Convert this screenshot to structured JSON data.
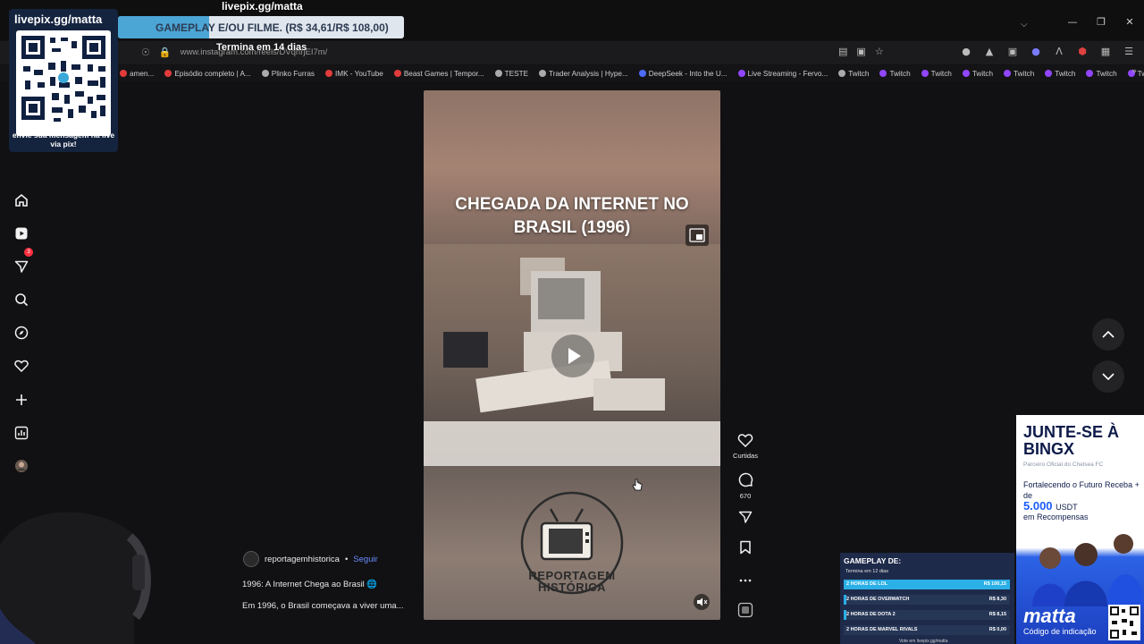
{
  "browser": {
    "url": "www.instagram.com/reels/DVqhrjEI7m/",
    "bookmarks": [
      {
        "label": "amen...",
        "color": "#e23b3b"
      },
      {
        "label": "Episódio completo | A...",
        "color": "#e23b3b"
      },
      {
        "label": "Plinko Furras",
        "color": "#aaaaaa"
      },
      {
        "label": "IMK - YouTube",
        "color": "#e23b3b"
      },
      {
        "label": "Beast Games | Tempor...",
        "color": "#e23b3b"
      },
      {
        "label": "TESTE",
        "color": "#aaaaaa"
      },
      {
        "label": "Trader Analysis | Hype...",
        "color": "#aaaaaa"
      },
      {
        "label": "DeepSeek - Into the U...",
        "color": "#4d6bfe"
      },
      {
        "label": "Live Streaming - Fervo...",
        "color": "#9146ff"
      },
      {
        "label": "Twitch",
        "color": "#aaaaaa"
      },
      {
        "label": "Twitch",
        "color": "#9146ff"
      },
      {
        "label": "Twitch",
        "color": "#9146ff"
      },
      {
        "label": "Twitch",
        "color": "#9146ff"
      },
      {
        "label": "Twitch",
        "color": "#9146ff"
      },
      {
        "label": "Twitch",
        "color": "#9146ff"
      },
      {
        "label": "Twitch",
        "color": "#9146ff"
      },
      {
        "label": "Twitch",
        "color": "#9146ff"
      }
    ]
  },
  "overlay": {
    "livepix_title": "livepix.gg/matta",
    "goal_text": "GAMEPLAY E/OU FILME. (R$ 34,61/R$ 108,00)",
    "goal_progress": 0.32,
    "goal_sub": "Termina em 14 dias",
    "qr_title": "livepix.gg/matta",
    "qr_caption": "envie sua mensagem na live via pix!"
  },
  "sidebar": {
    "notification_count": "3"
  },
  "reel": {
    "caption": "CHEGADA DA INTERNET NO BRASIL (1996)",
    "logo_text": "REPORTAGEM HISTÓRICA",
    "likes_label": "Curtidas",
    "comments_count": "670",
    "author": "reportagemhistorica",
    "separator": "•",
    "follow_label": "Seguir",
    "desc_line1": "1996: A Internet Chega ao Brasil 🌐",
    "desc_line2": "Em 1996, o Brasil começava a viver uma..."
  },
  "promo": {
    "title": "JUNTE-SE À BINGX",
    "subtitle": "Parceiro Oficial do Chelsea FC",
    "line1": "Fortalecendo o Futuro Receba + de",
    "amount": "5.000",
    "amount_unit": "USDT",
    "line2": "em Recompensas",
    "brand": "matta",
    "code_label": "Código de indicação"
  },
  "poll": {
    "title": "GAMEPLAY DE:",
    "subtitle": "Termina em 12 dias",
    "options": [
      {
        "label": "2 HORAS DE LOL",
        "value": "R$ 100,15",
        "share": 1.0
      },
      {
        "label": "2 HORAS DE OVERWATCH",
        "value": "R$ 8,30",
        "share": 0.04
      },
      {
        "label": "2 HORAS DE DOTA 2",
        "value": "R$ 8,15",
        "share": 0.04
      },
      {
        "label": "2 HORAS DE MARVEL RIVALS",
        "value": "R$ 0,00",
        "share": 0.0
      }
    ],
    "footer": "Vote em livepix.gg/matta"
  }
}
